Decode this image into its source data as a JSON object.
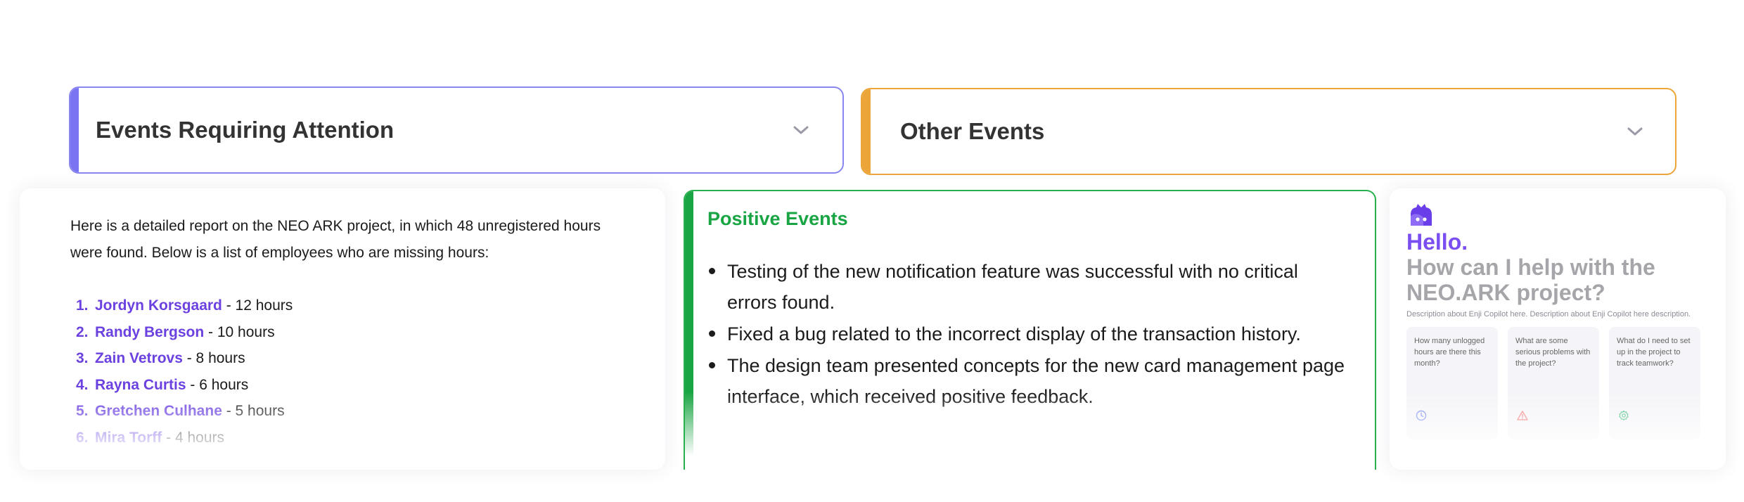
{
  "accordions": [
    {
      "title": "Events Requiring Attention",
      "accent": "#7b74f2"
    },
    {
      "title": "Other Events",
      "accent": "#eba538"
    }
  ],
  "report": {
    "intro": "Here is a detailed report on the NEO ARK project, in which 48 unregistered hours were found. Below is a list of employees who are missing hours:",
    "employees": [
      {
        "num": "1.",
        "name": "Jordyn Korsgaard",
        "hours": " - 12 hours"
      },
      {
        "num": "2.",
        "name": "Randy Bergson",
        "hours": " - 10 hours"
      },
      {
        "num": "3.",
        "name": "Zain Vetrovs",
        "hours": " - 8 hours"
      },
      {
        "num": "4.",
        "name": "Rayna Curtis",
        "hours": " - 6 hours"
      },
      {
        "num": "5.",
        "name": "Gretchen Culhane",
        "hours": " - 5 hours"
      },
      {
        "num": "6.",
        "name": "Mira Torff",
        "hours": " - 4 hours"
      }
    ]
  },
  "positive": {
    "title": "Positive Events",
    "accent": "#1aa544",
    "items": [
      "Testing of the new notification feature was successful with no critical errors found.",
      "Fixed a bug related to the incorrect display of the transaction history.",
      "The design team presented concepts for the new card management page interface, which received positive feedback."
    ]
  },
  "copilot": {
    "logo_icon": "enji-logo-icon",
    "hello": "Hello.",
    "question": "How can I help with the NEO.ARK project?",
    "description": "Description about Enji Copilot here. Description about Enji Copilot here description.",
    "suggestions": [
      {
        "text": "How many unlogged hours are there this month?",
        "icon": "clock-icon",
        "color": "#7a8cf0"
      },
      {
        "text": "What are some serious problems with the project?",
        "icon": "warning-icon",
        "color": "#f07a7a"
      },
      {
        "text": "What do I need to set up in the project to track teamwork?",
        "icon": "gear-icon",
        "color": "#3dba74"
      }
    ]
  }
}
